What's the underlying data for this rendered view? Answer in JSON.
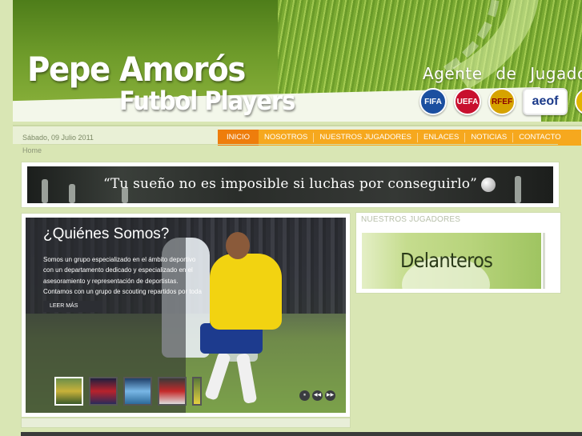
{
  "header": {
    "title_line1": "Pepe Amorós",
    "title_line2": "Futbol Players",
    "tagline": "Agente de Jugadores",
    "logos": [
      "FIFA",
      "UEFA",
      "RFEF",
      "aeof",
      ""
    ]
  },
  "topbar": {
    "date": "Sábado, 09 Julio 2011"
  },
  "nav": {
    "items": [
      "INICIO",
      "NOSOTROS",
      "NUESTROS JUGADORES",
      "ENLACES",
      "NOTICIAS",
      "CONTACTO"
    ],
    "active": "INICIO"
  },
  "breadcrumb": "Home",
  "banner": {
    "text": "“Tu sueño no es imposible si luchas por conseguirlo”"
  },
  "slider": {
    "title": "¿Quiénes Somos?",
    "text": "Somos un grupo especializado en el ámbito deportivo con un departamento dedicado y especializado en el asesoramiento y representación de deportistas. Contamos con un grupo de scouting repartidos por toda",
    "button": "LEER MÁS",
    "controls": [
      "⏸",
      "◀◀",
      "▶▶"
    ]
  },
  "panel": {
    "title": "NUESTROS JUGADORES",
    "image_text": "Delanteros"
  },
  "colors": {
    "nav_bg": "#f6a81e",
    "nav_active": "#ee7d0c",
    "page_bg": "#d9e6b4"
  }
}
